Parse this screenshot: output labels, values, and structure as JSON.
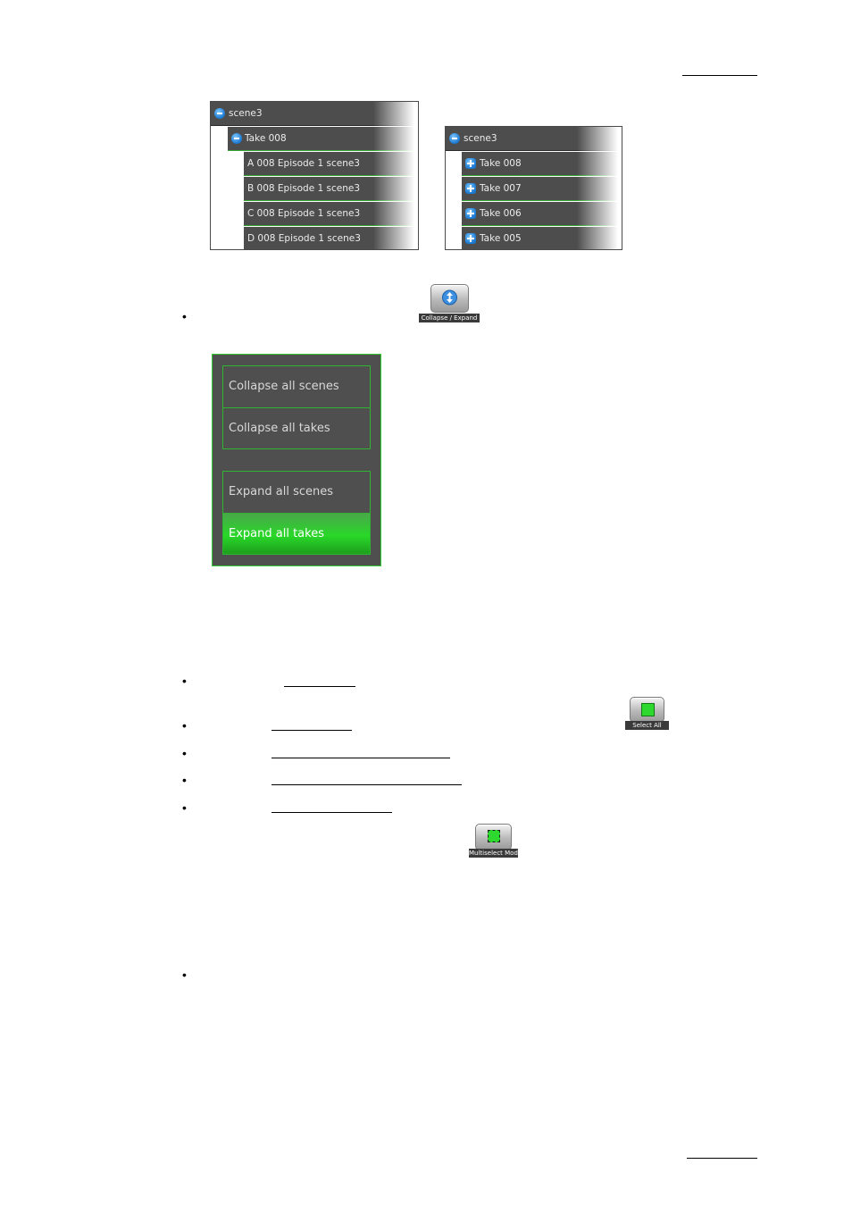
{
  "left_tree": {
    "rows": [
      {
        "label": "scene3",
        "icon": "minus"
      },
      {
        "label": "Take 008",
        "icon": "minus"
      },
      {
        "label": "A 008  Episode 1 scene3"
      },
      {
        "label": "B 008  Episode 1 scene3"
      },
      {
        "label": "C 008  Episode 1 scene3"
      },
      {
        "label": "D 008  Episode 1 scene3"
      }
    ]
  },
  "right_tree": {
    "rows": [
      {
        "label": "scene3",
        "icon": "minus"
      },
      {
        "label": "Take 008",
        "icon": "plus"
      },
      {
        "label": "Take 007",
        "icon": "plus"
      },
      {
        "label": "Take 006",
        "icon": "plus"
      },
      {
        "label": "Take 005",
        "icon": "plus"
      }
    ]
  },
  "buttons": {
    "collapse_expand": "Collapse / Expand",
    "select_all": "Select All",
    "multiselect": "Multiselect Mode"
  },
  "menu": {
    "collapse_scenes": "Collapse all scenes",
    "collapse_takes": "Collapse all takes",
    "expand_scenes": "Expand all scenes",
    "expand_takes": "Expand all takes"
  },
  "colors": {
    "row_bg": "#4d4d4d",
    "accent_green": "#2fb52f",
    "icon_blue": "#1a78d0"
  }
}
